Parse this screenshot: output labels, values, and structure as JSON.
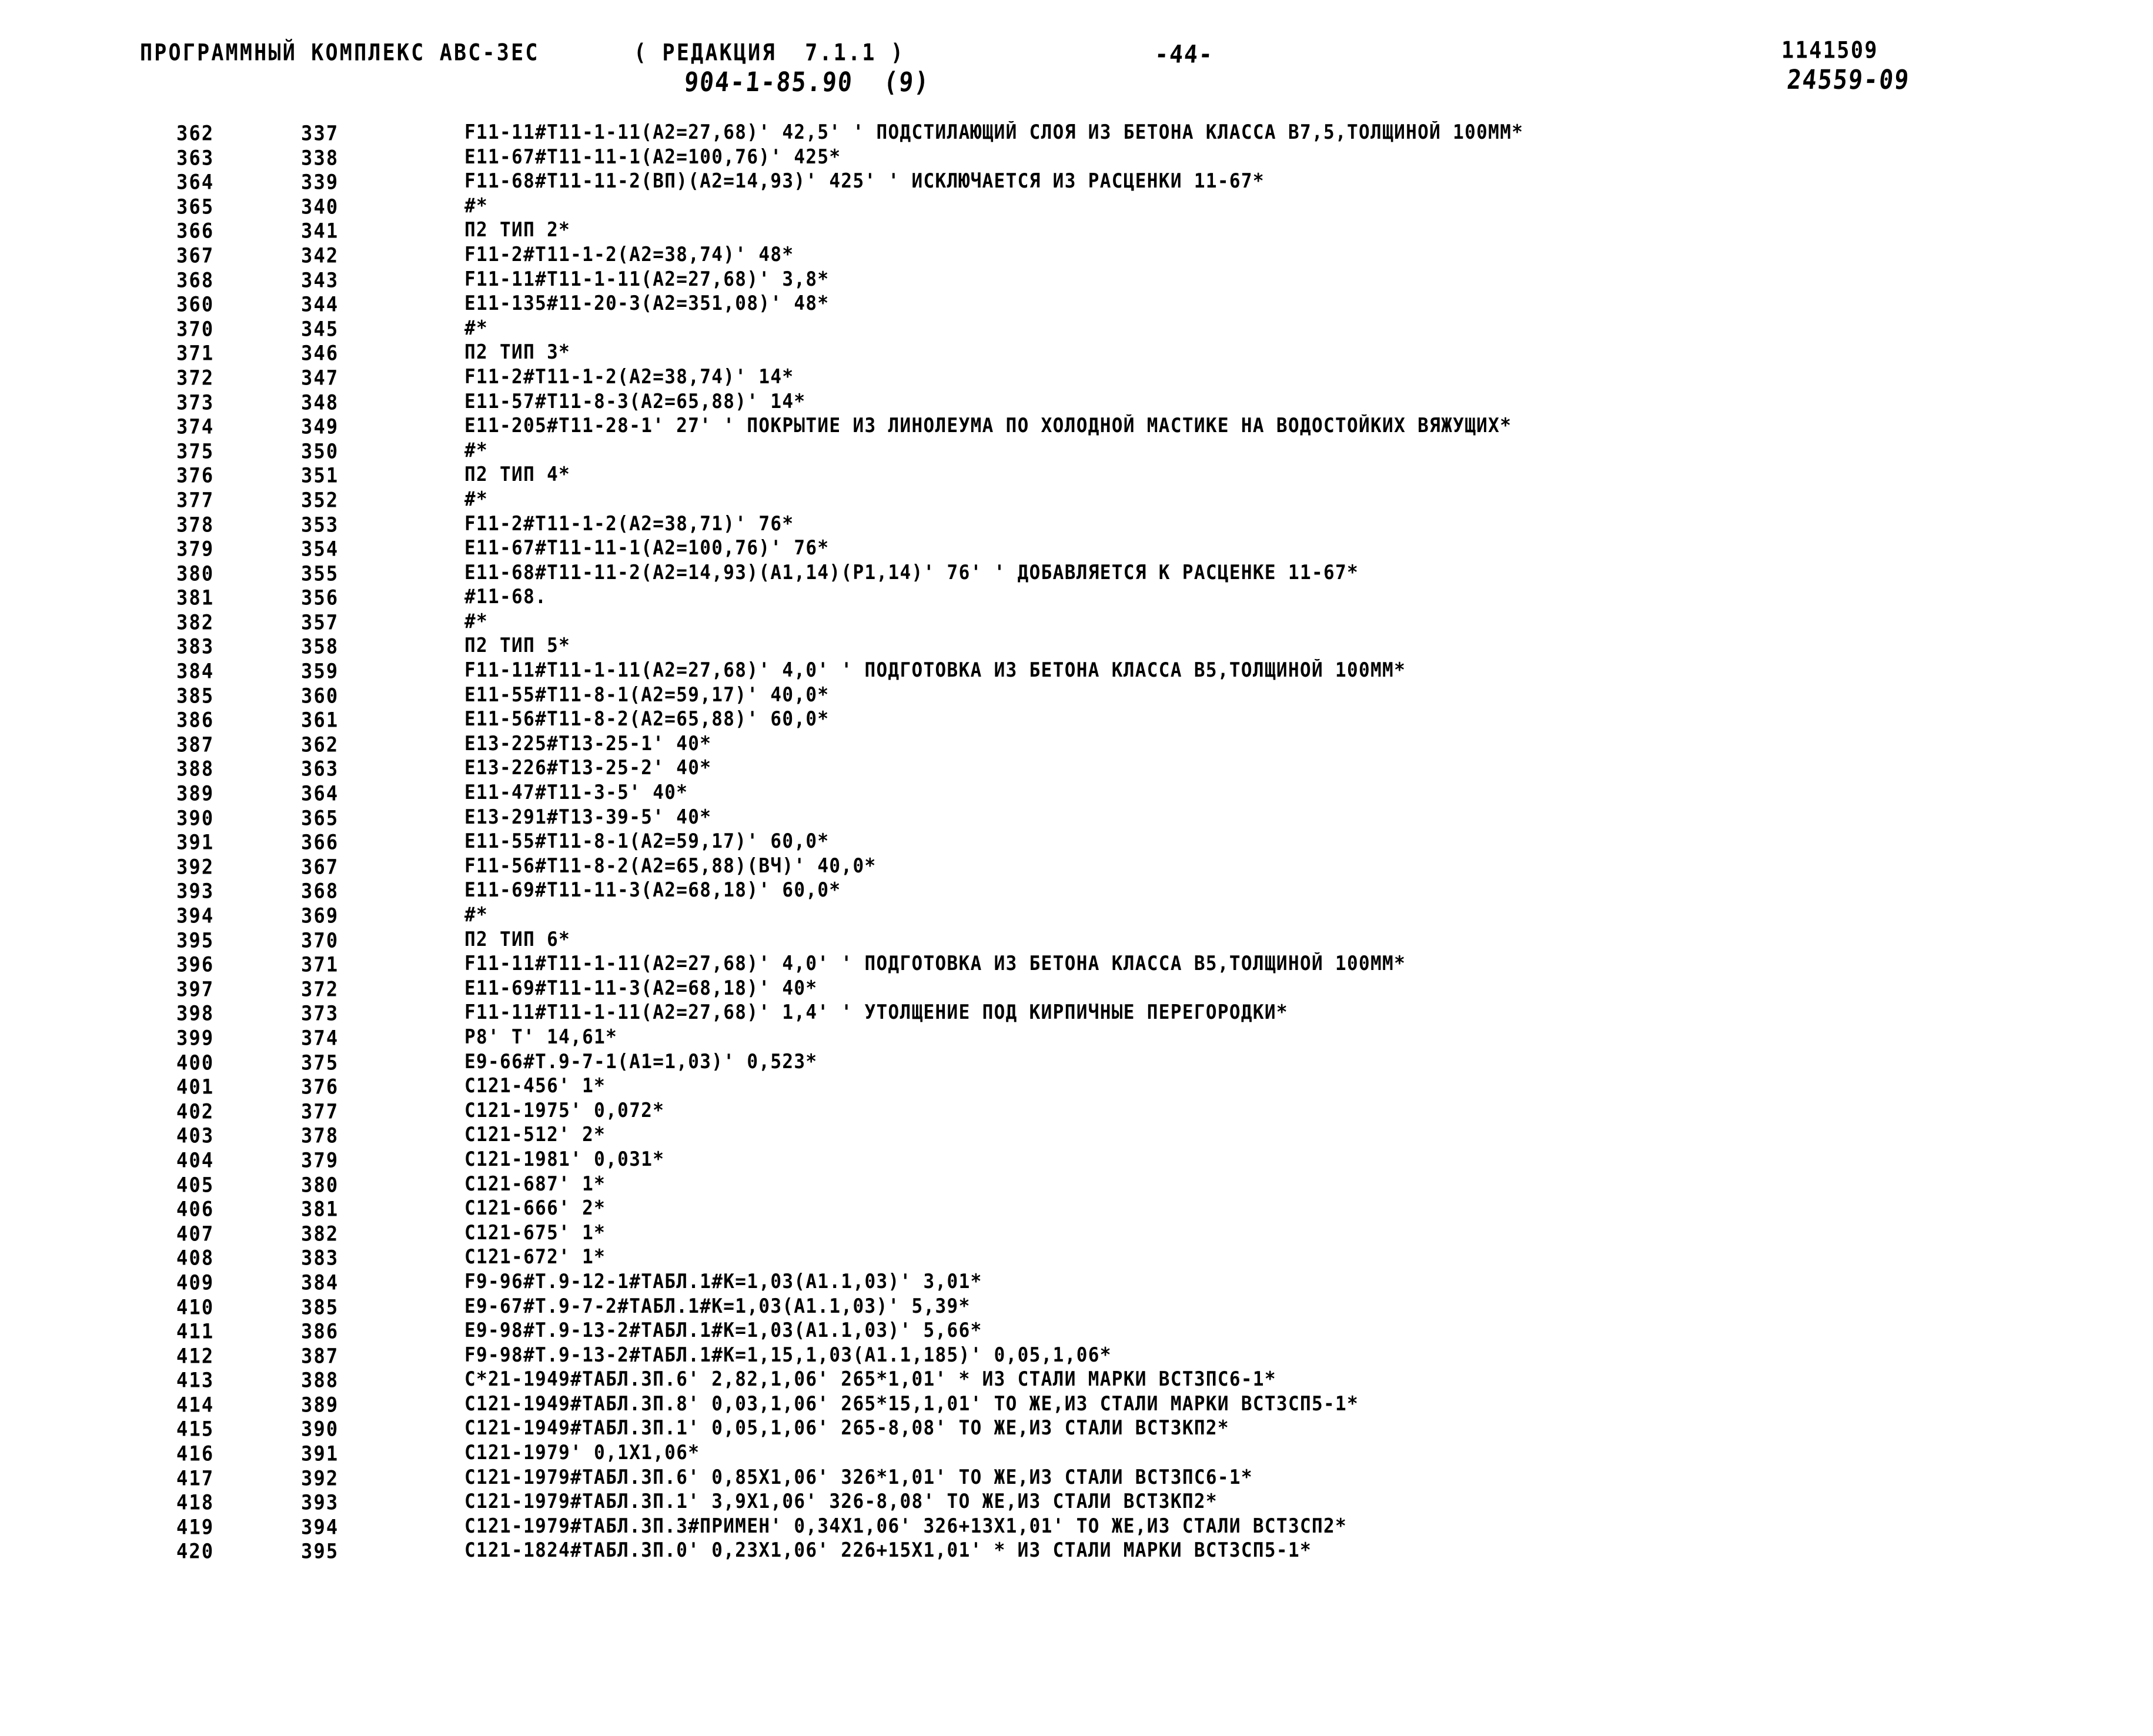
{
  "header": {
    "program_title": "ПРОГРАММНЫЙ КОМПЛЕКС АВС-3ЕС",
    "edition": "( РЕДАКЦИЯ  7.1.1 )",
    "document_code": "904-1-85.90  (9)",
    "page_number": "-44-",
    "doc_number": "1141509",
    "doc_id": "24559-09"
  },
  "listing": {
    "columns": [
      "seq",
      "num",
      "code"
    ],
    "rows": [
      {
        "seq": "362",
        "num": "337",
        "code": "F11-11#Т11-1-11(А2=27,68)' 42,5' ' ПОДСТИЛАЮЩИЙ СЛОЯ ИЗ БЕТОНА КЛАССА В7,5,ТОЛЩИНОЙ 100ММ*"
      },
      {
        "seq": "363",
        "num": "338",
        "code": "Е11-67#Т11-11-1(А2=100,76)' 425*"
      },
      {
        "seq": "364",
        "num": "339",
        "code": "F11-68#Т11-11-2(ВП)(А2=14,93)' 425' ' ИСКЛЮЧАЕТСЯ ИЗ РАСЦЕНКИ 11-67*"
      },
      {
        "seq": "365",
        "num": "340",
        "code": "#*"
      },
      {
        "seq": "366",
        "num": "341",
        "code": "П2 ТИП 2*"
      },
      {
        "seq": "367",
        "num": "342",
        "code": "F11-2#Т11-1-2(А2=38,74)' 48*"
      },
      {
        "seq": "368",
        "num": "343",
        "code": "F11-11#Т11-1-11(А2=27,68)' 3,8*"
      },
      {
        "seq": "360",
        "num": "344",
        "code": "E11-135#11-20-3(А2=351,08)' 48*"
      },
      {
        "seq": "370",
        "num": "345",
        "code": "#*"
      },
      {
        "seq": "371",
        "num": "346",
        "code": "П2 ТИП 3*"
      },
      {
        "seq": "372",
        "num": "347",
        "code": "F11-2#Т11-1-2(А2=38,74)' 14*"
      },
      {
        "seq": "373",
        "num": "348",
        "code": "Е11-57#Т11-8-3(А2=65,88)' 14*"
      },
      {
        "seq": "374",
        "num": "349",
        "code": "Е11-205#Т11-28-1' 27' ' ПОКРЫТИЕ ИЗ ЛИНОЛЕУМА ПО ХОЛОДНОЙ МАСТИКЕ НА ВОДОСТОЙКИХ ВЯЖУЩИХ*"
      },
      {
        "seq": "375",
        "num": "350",
        "code": "#*"
      },
      {
        "seq": "376",
        "num": "351",
        "code": "П2 ТИП 4*"
      },
      {
        "seq": "377",
        "num": "352",
        "code": "#*"
      },
      {
        "seq": "378",
        "num": "353",
        "code": "F11-2#Т11-1-2(А2=38,71)' 76*"
      },
      {
        "seq": "379",
        "num": "354",
        "code": "Е11-67#Т11-11-1(А2=100,76)' 76*"
      },
      {
        "seq": "380",
        "num": "355",
        "code": "Е11-68#Т11-11-2(А2=14,93)(А1,14)(Р1,14)' 76' ' ДОБАВЛЯЕТСЯ К РАСЦЕНКЕ 11-67*"
      },
      {
        "seq": "381",
        "num": "356",
        "code": "#11-68."
      },
      {
        "seq": "382",
        "num": "357",
        "code": "#*"
      },
      {
        "seq": "383",
        "num": "358",
        "code": "П2 ТИП 5*"
      },
      {
        "seq": "384",
        "num": "359",
        "code": "F11-11#Т11-1-11(А2=27,68)' 4,0' ' ПОДГОТОВКА ИЗ БЕТОНА КЛАССА В5,ТОЛЩИНОЙ 100ММ*"
      },
      {
        "seq": "385",
        "num": "360",
        "code": "Е11-55#Т11-8-1(А2=59,17)' 40,0*"
      },
      {
        "seq": "386",
        "num": "361",
        "code": "Е11-56#Т11-8-2(А2=65,88)' 60,0*"
      },
      {
        "seq": "387",
        "num": "362",
        "code": "Е13-225#Т13-25-1' 40*"
      },
      {
        "seq": "388",
        "num": "363",
        "code": "Е13-226#Т13-25-2' 40*"
      },
      {
        "seq": "389",
        "num": "364",
        "code": "Е11-47#Т11-3-5' 40*"
      },
      {
        "seq": "390",
        "num": "365",
        "code": "Е13-291#Т13-39-5' 40*"
      },
      {
        "seq": "391",
        "num": "366",
        "code": "Е11-55#Т11-8-1(А2=59,17)' 60,0*"
      },
      {
        "seq": "392",
        "num": "367",
        "code": "F11-56#Т11-8-2(А2=65,88)(ВЧ)' 40,0*"
      },
      {
        "seq": "393",
        "num": "368",
        "code": "Е11-69#Т11-11-3(А2=68,18)' 60,0*"
      },
      {
        "seq": "394",
        "num": "369",
        "code": "#*"
      },
      {
        "seq": "395",
        "num": "370",
        "code": "П2 ТИП 6*"
      },
      {
        "seq": "396",
        "num": "371",
        "code": "F11-11#Т11-1-11(А2=27,68)' 4,0' ' ПОДГОТОВКА ИЗ БЕТОНА КЛАССА В5,ТОЛЩИНОЙ 100ММ*"
      },
      {
        "seq": "397",
        "num": "372",
        "code": "Е11-69#Т11-11-3(А2=68,18)' 40*"
      },
      {
        "seq": "398",
        "num": "373",
        "code": "F11-11#Т11-1-11(А2=27,68)' 1,4' ' УТОЛЩЕНИЕ ПОД КИРПИЧНЫЕ ПЕРЕГОРОДКИ*"
      },
      {
        "seq": "399",
        "num": "374",
        "code": "Р8' Т' 14,61*"
      },
      {
        "seq": "400",
        "num": "375",
        "code": "Е9-66#Т.9-7-1(А1=1,03)' 0,523*"
      },
      {
        "seq": "401",
        "num": "376",
        "code": "С121-456' 1*"
      },
      {
        "seq": "402",
        "num": "377",
        "code": "С121-1975' 0,072*"
      },
      {
        "seq": "403",
        "num": "378",
        "code": "С121-512' 2*"
      },
      {
        "seq": "404",
        "num": "379",
        "code": "С121-1981' 0,031*"
      },
      {
        "seq": "405",
        "num": "380",
        "code": "С121-687' 1*"
      },
      {
        "seq": "406",
        "num": "381",
        "code": "С121-666' 2*"
      },
      {
        "seq": "407",
        "num": "382",
        "code": "С121-675' 1*"
      },
      {
        "seq": "408",
        "num": "383",
        "code": "С121-672' 1*"
      },
      {
        "seq": "409",
        "num": "384",
        "code": "F9-96#Т.9-12-1#ТАБЛ.1#К=1,03(А1.1,03)' 3,01*"
      },
      {
        "seq": "410",
        "num": "385",
        "code": "Е9-67#Т.9-7-2#ТАБЛ.1#К=1,03(А1.1,03)' 5,39*"
      },
      {
        "seq": "411",
        "num": "386",
        "code": "Е9-98#Т.9-13-2#ТАБЛ.1#К=1,03(А1.1,03)' 5,66*"
      },
      {
        "seq": "412",
        "num": "387",
        "code": "F9-98#Т.9-13-2#ТАБЛ.1#К=1,15,1,03(А1.1,185)' 0,05,1,06*"
      },
      {
        "seq": "413",
        "num": "388",
        "code": "С*21-1949#ТАБЛ.3П.6' 2,82,1,06' 265*1,01' * ИЗ СТАЛИ МАРКИ ВСТ3ПС6-1*"
      },
      {
        "seq": "414",
        "num": "389",
        "code": "С121-1949#ТАБЛ.3П.8' 0,03,1,06' 265*15,1,01' ТО ЖЕ,ИЗ СТАЛИ МАРКИ ВСТ3СП5-1*"
      },
      {
        "seq": "415",
        "num": "390",
        "code": "С121-1949#ТАБЛ.3П.1' 0,05,1,06' 265-8,08' ТО ЖЕ,ИЗ СТАЛИ ВСТ3КП2*"
      },
      {
        "seq": "416",
        "num": "391",
        "code": "С121-1979' 0,1Х1,06*"
      },
      {
        "seq": "417",
        "num": "392",
        "code": "С121-1979#ТАБЛ.3П.6' 0,85Х1,06' 326*1,01' ТО ЖЕ,ИЗ СТАЛИ ВСТ3ПС6-1*"
      },
      {
        "seq": "418",
        "num": "393",
        "code": "С121-1979#ТАБЛ.3П.1' 3,9Х1,06' 326-8,08' ТО ЖЕ,ИЗ СТАЛИ ВСТ3КП2*"
      },
      {
        "seq": "419",
        "num": "394",
        "code": "С121-1979#ТАБЛ.3П.3#ПРИМЕН' 0,34Х1,06' 326+13Х1,01' ТО ЖЕ,ИЗ СТАЛИ ВСТ3СП2*"
      },
      {
        "seq": "420",
        "num": "395",
        "code": "С121-1824#ТАБЛ.3П.0' 0,23Х1,06' 226+15Х1,01' * ИЗ СТАЛИ МАРКИ ВСТ3СП5-1*"
      }
    ]
  }
}
